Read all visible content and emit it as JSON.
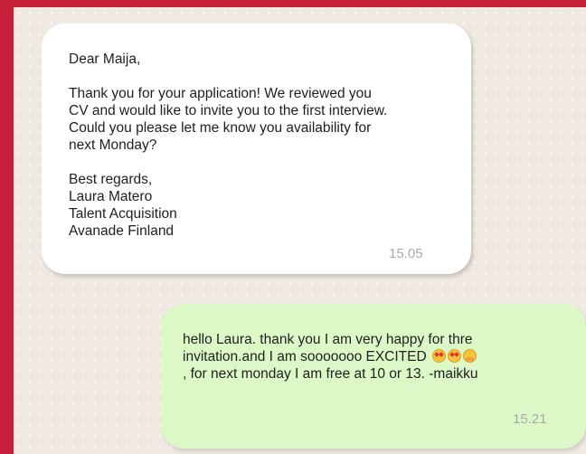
{
  "messages": {
    "incoming": {
      "lines": [
        "Dear Maija,",
        "",
        "Thank you for your application! We reviewed you",
        "CV and would like to invite you to the first interview.",
        "Could you please let me know you availability for",
        "next Monday?",
        "",
        "Best regards,",
        "Laura Matero",
        "Talent Acquisition",
        "Avanade Finland"
      ],
      "time": "15.05"
    },
    "outgoing": {
      "line1": "hello Laura. thank you I am very happy for thre",
      "line2": "invitation.and I am sooooooo EXCITED",
      "line3": ", for next monday I am free at 10 or 13. -maikku",
      "emojis": [
        "star-struck-emoji",
        "heart-eyes-emoji",
        "hugging-emoji"
      ],
      "time": "15.21"
    }
  },
  "colors": {
    "frame": "#c8203a",
    "chat_background": "#efe9e2",
    "incoming_bubble": "#ffffff",
    "outgoing_bubble": "#dcf8c6",
    "timestamp": "#a9a9a9"
  }
}
